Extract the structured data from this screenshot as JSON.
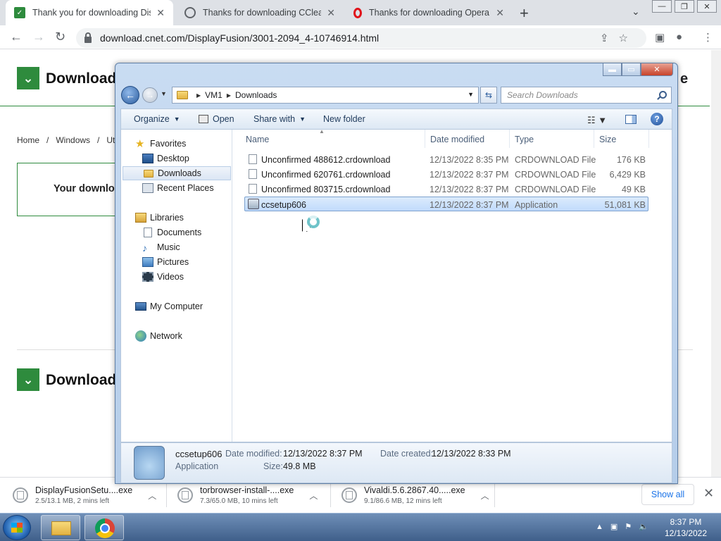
{
  "browser": {
    "tabs": [
      {
        "title": "Thank you for downloading DisplayFusion",
        "icon": "cnet-icon",
        "active": true
      },
      {
        "title": "Thanks for downloading CCleaner",
        "icon": "globe-icon",
        "active": false
      },
      {
        "title": "Thanks for downloading Opera",
        "icon": "opera-icon",
        "active": false
      }
    ],
    "url": "download.cnet.com/DisplayFusion/3001-2094_4-10746914.html",
    "page": {
      "heading_top": "Download",
      "heading_bottom": "Download",
      "breadcrumb": "Home   /   Windows   /   Utili",
      "thank_text": "Your downlo",
      "right_fragment": "e"
    },
    "downloads": [
      {
        "name": "DisplayFusionSetu....exe",
        "status": "2.5/13.1 MB, 2 mins left"
      },
      {
        "name": "torbrowser-install-....exe",
        "status": "7.3/65.0 MB, 10 mins left"
      },
      {
        "name": "Vivaldi.5.6.2867.40.....exe",
        "status": "9.1/86.6 MB, 12 mins left"
      }
    ],
    "show_all": "Show all"
  },
  "explorer": {
    "breadcrumb": [
      "VM1",
      "Downloads"
    ],
    "search_placeholder": "Search Downloads",
    "commands": {
      "organize": "Organize",
      "open": "Open",
      "share_with": "Share with",
      "new_folder": "New folder"
    },
    "nav": {
      "favorites": "Favorites",
      "desktop": "Desktop",
      "downloads": "Downloads",
      "recent_places": "Recent Places",
      "libraries": "Libraries",
      "documents": "Documents",
      "music": "Music",
      "pictures": "Pictures",
      "videos": "Videos",
      "computer": "My Computer",
      "network": "Network"
    },
    "columns": {
      "name": "Name",
      "date": "Date modified",
      "type": "Type",
      "size": "Size"
    },
    "files": [
      {
        "name": "Unconfirmed 488612.crdownload",
        "date": "12/13/2022 8:35 PM",
        "type": "CRDOWNLOAD File",
        "size": "176 KB"
      },
      {
        "name": "Unconfirmed 620761.crdownload",
        "date": "12/13/2022 8:37 PM",
        "type": "CRDOWNLOAD File",
        "size": "6,429 KB"
      },
      {
        "name": "Unconfirmed 803715.crdownload",
        "date": "12/13/2022 8:37 PM",
        "type": "CRDOWNLOAD File",
        "size": "49 KB"
      },
      {
        "name": "ccsetup606",
        "date": "12/13/2022 8:37 PM",
        "type": "Application",
        "size": "51,081 KB"
      }
    ],
    "details": {
      "name": "ccsetup606",
      "kind": "Application",
      "modified_label": "Date modified:",
      "modified": "12/13/2022 8:37 PM",
      "created_label": "Date created:",
      "created": "12/13/2022 8:33 PM",
      "size_label": "Size:",
      "size": "49.8 MB"
    }
  },
  "taskbar": {
    "time": "8:37 PM",
    "date": "12/13/2022"
  }
}
